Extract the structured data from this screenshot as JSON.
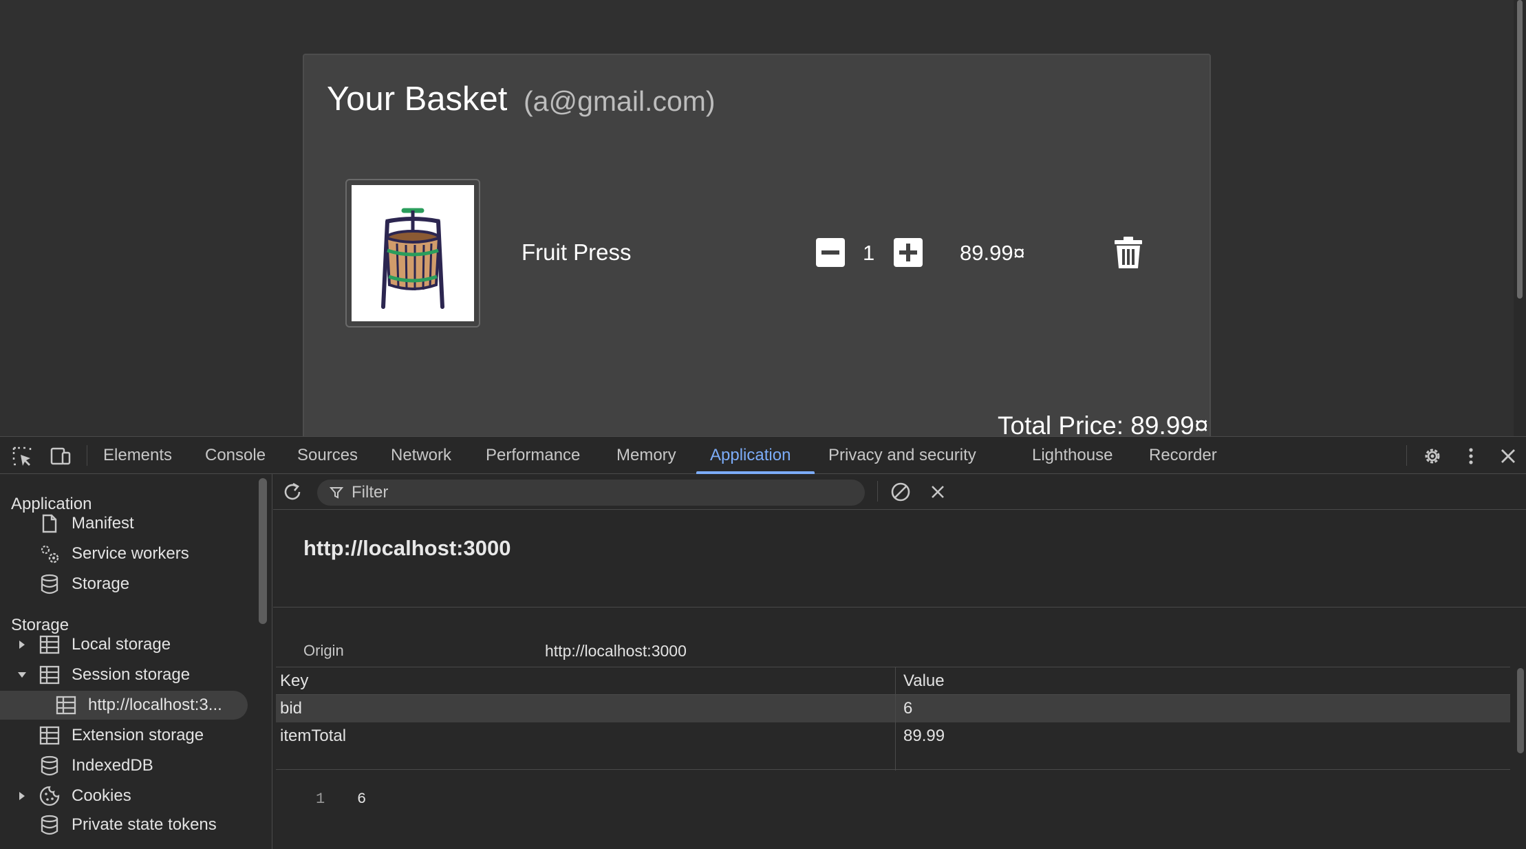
{
  "page": {
    "basket_title": "Your Basket",
    "user_email": "(a@gmail.com)",
    "item": {
      "name": "Fruit Press",
      "quantity": "1",
      "price": "89.99¤",
      "image_icon": "fruit-press-image"
    },
    "total_price": "Total Price: 89.99¤"
  },
  "devtools": {
    "tabs": [
      "Elements",
      "Console",
      "Sources",
      "Network",
      "Performance",
      "Memory",
      "Application",
      "Privacy and security",
      "Lighthouse",
      "Recorder"
    ],
    "active_tab": "Application",
    "sidebar": {
      "application_heading": "Application",
      "application_items": [
        "Manifest",
        "Service workers",
        "Storage"
      ],
      "storage_heading": "Storage",
      "storage_items": [
        "Local storage",
        "Session storage",
        "http://localhost:3...",
        "Extension storage",
        "IndexedDB",
        "Cookies",
        "Private state tokens"
      ]
    },
    "filter_placeholder": "Filter",
    "origin_title": "http://localhost:3000",
    "origin_label": "Origin",
    "origin_value": "http://localhost:3000",
    "table": {
      "headers": [
        "Key",
        "Value"
      ],
      "rows": [
        {
          "key": "bid",
          "value": "6"
        },
        {
          "key": "itemTotal",
          "value": "89.99"
        }
      ]
    },
    "preview": {
      "line_number": "1",
      "value": "6"
    }
  },
  "colors": {
    "accent": "#7cacf8",
    "page_bg": "#303030",
    "card_bg": "#424242",
    "devtools_bg": "#282828"
  }
}
